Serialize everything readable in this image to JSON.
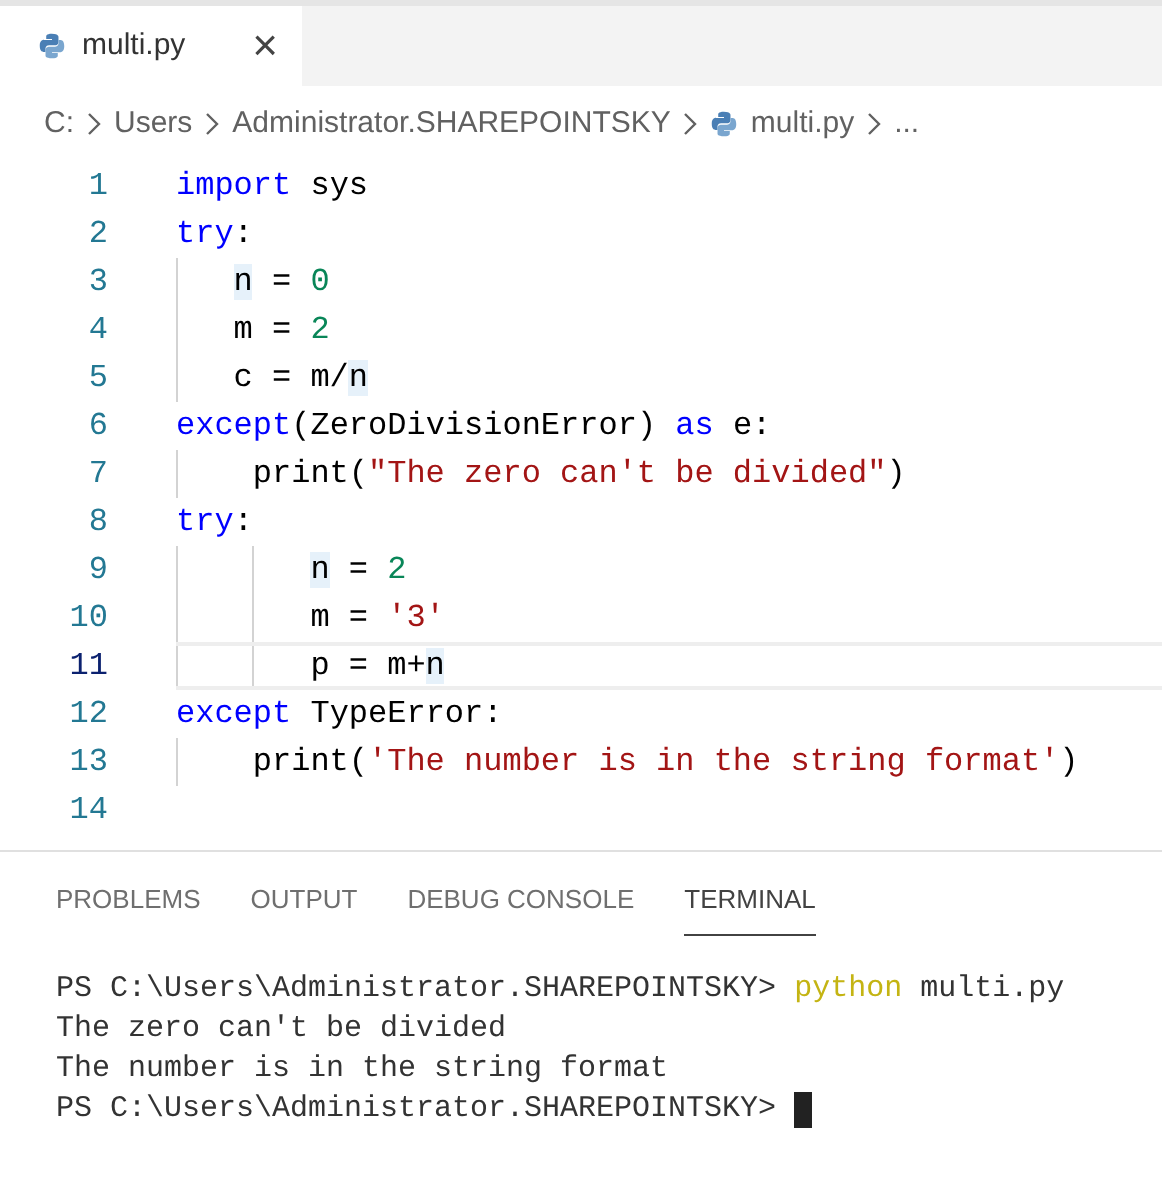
{
  "tabs": [
    {
      "label": "multi.py",
      "close": "×",
      "selected": true
    }
  ],
  "breadcrumbs": [
    {
      "label": "C:",
      "kind": "folder"
    },
    {
      "label": "Users",
      "kind": "folder"
    },
    {
      "label": "Administrator.SHAREPOINTSKY",
      "kind": "folder"
    },
    {
      "label": "multi.py",
      "kind": "file"
    },
    {
      "label": "...",
      "kind": "folder"
    }
  ],
  "code_lines": [
    {
      "number": "1",
      "current": false,
      "tokens": [
        {
          "text": "import",
          "kind": "keyword"
        },
        {
          "text": " sys",
          "kind": "plain"
        }
      ]
    },
    {
      "number": "2",
      "current": false,
      "tokens": [
        {
          "text": "try",
          "kind": "keyword"
        },
        {
          "text": ":",
          "kind": "plain"
        }
      ]
    },
    {
      "number": "3",
      "current": false,
      "indent": [
        {
          "kind": "narrow"
        }
      ],
      "tokens": [
        {
          "text": "n",
          "kind": "highlight"
        },
        {
          "text": " = ",
          "kind": "plain"
        },
        {
          "text": "0",
          "kind": "number"
        }
      ]
    },
    {
      "number": "4",
      "current": false,
      "indent": [
        {
          "kind": "narrow"
        }
      ],
      "tokens": [
        {
          "text": "m = ",
          "kind": "plain"
        },
        {
          "text": "2",
          "kind": "number"
        }
      ]
    },
    {
      "number": "5",
      "current": false,
      "indent": [
        {
          "kind": "narrow"
        }
      ],
      "tokens": [
        {
          "text": "c = m/",
          "kind": "plain"
        },
        {
          "text": "n",
          "kind": "highlight"
        }
      ]
    },
    {
      "number": "6",
      "current": false,
      "tokens": [
        {
          "text": "except",
          "kind": "keyword"
        },
        {
          "text": "(ZeroDivisionError) ",
          "kind": "plain"
        },
        {
          "text": "as",
          "kind": "keyword"
        },
        {
          "text": " e:",
          "kind": "plain"
        }
      ]
    },
    {
      "number": "7",
      "current": false,
      "indent": [
        {
          "kind": "wide"
        }
      ],
      "tokens": [
        {
          "text": "print(",
          "kind": "plain"
        },
        {
          "text": "\"The zero can't be divided\"",
          "kind": "string"
        },
        {
          "text": ")",
          "kind": "plain"
        }
      ]
    },
    {
      "number": "8",
      "current": false,
      "tokens": [
        {
          "text": "try",
          "kind": "keyword"
        },
        {
          "text": ":",
          "kind": "plain"
        }
      ]
    },
    {
      "number": "9",
      "current": false,
      "indent": [
        {
          "kind": "wide"
        },
        {
          "kind": "narrow"
        }
      ],
      "tokens": [
        {
          "text": "n",
          "kind": "highlight"
        },
        {
          "text": " = ",
          "kind": "plain"
        },
        {
          "text": "2",
          "kind": "number"
        }
      ]
    },
    {
      "number": "10",
      "current": false,
      "indent": [
        {
          "kind": "wide"
        },
        {
          "kind": "narrow"
        }
      ],
      "tokens": [
        {
          "text": "m = ",
          "kind": "plain"
        },
        {
          "text": "'3'",
          "kind": "string"
        }
      ]
    },
    {
      "number": "11",
      "current": true,
      "indent": [
        {
          "kind": "wide"
        },
        {
          "kind": "narrow"
        }
      ],
      "tokens": [
        {
          "text": "p = m+",
          "kind": "plain"
        },
        {
          "text": "n",
          "kind": "highlight"
        }
      ]
    },
    {
      "number": "12",
      "current": false,
      "tokens": [
        {
          "text": "except",
          "kind": "keyword"
        },
        {
          "text": " TypeError:",
          "kind": "plain"
        }
      ]
    },
    {
      "number": "13",
      "current": false,
      "indent": [
        {
          "kind": "wide"
        }
      ],
      "tokens": [
        {
          "text": "print(",
          "kind": "plain"
        },
        {
          "text": "'The number is in the string format'",
          "kind": "string"
        },
        {
          "text": ")",
          "kind": "plain"
        }
      ]
    },
    {
      "number": "14",
      "current": false
    }
  ],
  "panel_tabs": [
    {
      "label": "PROBLEMS",
      "selected": false
    },
    {
      "label": "OUTPUT",
      "selected": false
    },
    {
      "label": "DEBUG CONSOLE",
      "selected": false
    },
    {
      "label": "TERMINAL",
      "selected": true
    }
  ],
  "terminal_lines": [
    {
      "segments": [
        {
          "text": "PS C:\\Users\\Administrator.SHAREPOINTSKY> ",
          "kind": "plain"
        },
        {
          "text": "python",
          "kind": "command"
        },
        {
          "text": " multi.py",
          "kind": "plain"
        }
      ],
      "cursor": false
    },
    {
      "segments": [
        {
          "text": "The zero can't be divided",
          "kind": "plain"
        }
      ],
      "cursor": false
    },
    {
      "segments": [
        {
          "text": "The number is in the string format",
          "kind": "plain"
        }
      ],
      "cursor": false
    },
    {
      "segments": [
        {
          "text": "PS C:\\Users\\Administrator.SHAREPOINTSKY> ",
          "kind": "plain"
        }
      ],
      "cursor": true
    }
  ]
}
